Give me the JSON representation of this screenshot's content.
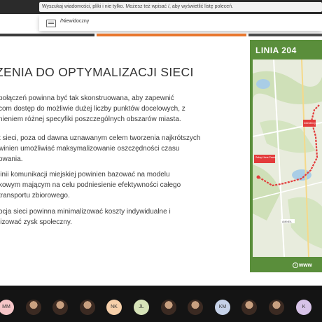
{
  "search": {
    "text": "Wyszukaj wiadomości, pliki i nie tylko. Możesz też wpisać /, aby wyświetlić listę poleceń."
  },
  "command_menu": {
    "item_label": "/Niewidoczny"
  },
  "slide": {
    "title": "ZENIA DO OPTYMALIZACJI SIECI",
    "paragraphs": [
      [
        "połączeń powinna być tak skonstruowana, aby zapewnić",
        "com dostęp do możliwie dużej liczby punktów docelowych, z",
        "nieniem różnej specyfiki poszczególnych obszarów miasta."
      ],
      [
        "t sieci, poza od dawna uznawanym celem tworzenia najkrótszych",
        "winien umożliwiać maksymalizowanie oszczędności czasu",
        "owania."
      ],
      [
        "linii komunikacji miejskiej powinien bazować na modelu",
        "kowym mającym na celu podniesienie efektywności całego",
        "transportu zbiorowego."
      ],
      [
        "ocja sieci powinna minimalizować koszty indywidualne i",
        "lizować zysk społeczny."
      ]
    ]
  },
  "map": {
    "title": "LINIA 204",
    "footer": "www",
    "route_color": "#e33b3b",
    "labels": [
      "Zakręt Jana Pawła",
      "Dziewierzy",
      "AMINEA"
    ]
  },
  "participants": [
    {
      "initials": "MM",
      "color": "#f5c5c7"
    },
    {
      "initials": "",
      "color": "photo"
    },
    {
      "initials": "",
      "color": "photo"
    },
    {
      "initials": "",
      "color": "photo"
    },
    {
      "initials": "NK",
      "color": "#f6cfa9"
    },
    {
      "initials": "JL",
      "color": "#d6e3b8"
    },
    {
      "initials": "",
      "color": "photo"
    },
    {
      "initials": "",
      "color": "photo"
    },
    {
      "initials": "KM",
      "color": "#c6d2e8"
    },
    {
      "initials": "",
      "color": "photo"
    },
    {
      "initials": "",
      "color": "photo"
    },
    {
      "initials": "K",
      "color": "#d7c3e8"
    }
  ]
}
